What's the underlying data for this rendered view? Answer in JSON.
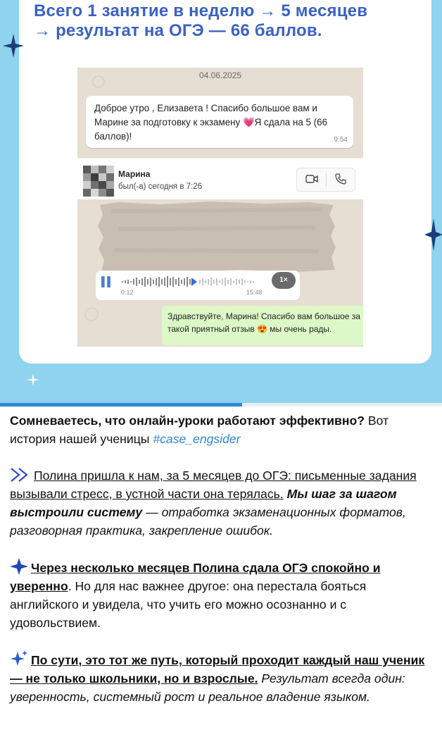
{
  "banner": {
    "headline_line1": "Всего 1 занятие в неделю → 5 месяцев",
    "headline_line2": "→ результат на ОГЭ — 66 баллов."
  },
  "chat": {
    "date": "04.06.2025",
    "incoming_message": "Доброе утро , Елизавета ! Спасибо большое вам и Марине за подготовку к экзамену 💗Я сдала на 5 (66 баллов)!",
    "incoming_time": "9:54",
    "contact_name": "Марина",
    "contact_status": "был(-а) сегодня в 7:26",
    "voice_elapsed": "0:12",
    "voice_duration": "15:48",
    "voice_speed": "1×",
    "reply_message": "Здравствуйте, Марина! Спасибо вам большое за такой приятный отзыв 😍 мы очень рады."
  },
  "progress": {
    "fraction": 0.548
  },
  "post": {
    "intro_bold": "Сомневаетесь, что онлайн-уроки работают эффективно?",
    "intro_rest": " Вот история нашей ученицы ",
    "hashtag": "#case_engsider",
    "p1_underlined": "Полина пришла к нам, за 5 месяцев до ОГЭ: письменные задания вызывали стресс, в устной части она терялась.",
    "p1_bold_italic": "Мы шаг за шагом выстроили систему",
    "p1_italic": " — отработка экзаменационных форматов, разговорная практика, закрепление ошибок.",
    "p2_bold_underlined": "Через несколько месяцев Полина сдала ОГЭ спокойно и уверенно",
    "p2_rest": ". Но для нас важнее другое: она перестала бояться английского и увидела, что учить его можно осознанно и с удовольствием.",
    "p3_bold_underlined": "По сути, это тот же путь, который проходит каждый наш ученик — не только школьники, но и взрослые.",
    "p3_italic": " Результат всегда один: уверенность, системный рост и реальное владение языком.",
    "icons": [
      "double-chevron-icon",
      "star-icon",
      "sparkles-icon"
    ],
    "colors": {
      "accent": "#2f86d6",
      "banner": "#8fd3ef",
      "headline": "#3a62c4"
    }
  }
}
